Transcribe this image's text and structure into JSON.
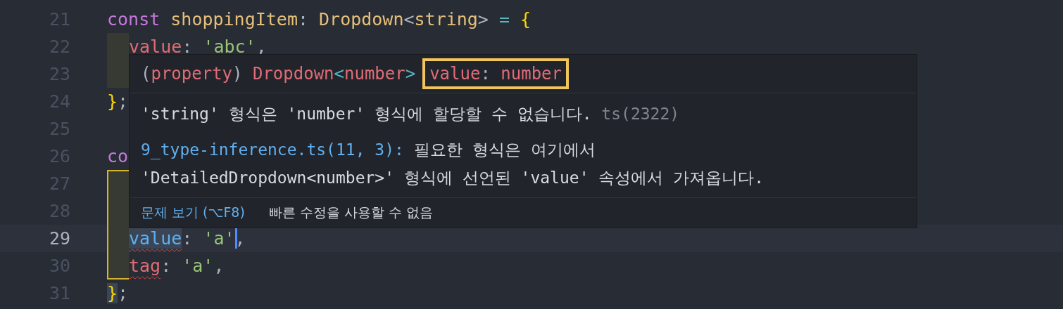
{
  "editor": {
    "lines": [
      {
        "number": "21",
        "active": false,
        "tokens": [
          {
            "text": "const",
            "kind": "keyword"
          },
          {
            "text": " shoppingItem",
            "kind": "type"
          },
          {
            "text": ": ",
            "kind": "punct"
          },
          {
            "text": "Dropdown",
            "kind": "type"
          },
          {
            "text": "<",
            "kind": "punct"
          },
          {
            "text": "string",
            "kind": "type"
          },
          {
            "text": ">",
            "kind": "punct"
          },
          {
            "text": " = ",
            "kind": "operator"
          },
          {
            "text": "{",
            "kind": "brace"
          }
        ]
      },
      {
        "number": "22",
        "active": false,
        "indent": true,
        "tokens": [
          {
            "text": "value",
            "kind": "property"
          },
          {
            "text": ": ",
            "kind": "punct"
          },
          {
            "text": "'abc'",
            "kind": "string"
          },
          {
            "text": ",",
            "kind": "punct"
          }
        ]
      },
      {
        "number": "23",
        "active": false,
        "indent": true
      },
      {
        "number": "24",
        "active": false,
        "tokens": [
          {
            "text": "}",
            "kind": "brace"
          },
          {
            "text": ";",
            "kind": "punct"
          }
        ]
      },
      {
        "number": "25",
        "active": false
      },
      {
        "number": "26",
        "active": false,
        "tokens": [
          {
            "text": "co",
            "kind": "keyword"
          }
        ]
      },
      {
        "number": "27",
        "active": false,
        "indent": true,
        "bracket_guide": true
      },
      {
        "number": "28",
        "active": false,
        "indent": true,
        "bracket_guide": true
      },
      {
        "number": "29",
        "active": true,
        "indent": true,
        "bracket_guide": true,
        "tokens": [
          {
            "text": "value",
            "kind": "link",
            "error": true,
            "highlighted": true
          },
          {
            "text": ": ",
            "kind": "punct"
          },
          {
            "text": "'a'",
            "kind": "string",
            "cursor": true
          },
          {
            "text": ",",
            "kind": "punct"
          }
        ]
      },
      {
        "number": "30",
        "active": false,
        "indent": true,
        "bracket_guide": true,
        "tokens": [
          {
            "text": "tag",
            "kind": "property",
            "error": true
          },
          {
            "text": ": ",
            "kind": "punct"
          },
          {
            "text": "'a'",
            "kind": "string"
          },
          {
            "text": ",",
            "kind": "punct"
          }
        ]
      },
      {
        "number": "31",
        "active": false,
        "tokens": [
          {
            "text": "}",
            "kind": "brace",
            "highlighted": true
          },
          {
            "text": ";",
            "kind": "punct"
          }
        ]
      }
    ]
  },
  "hover": {
    "signature": [
      {
        "text": "(",
        "kind": "punct"
      },
      {
        "text": "property",
        "kind": "property"
      },
      {
        "text": ") ",
        "kind": "punct"
      },
      {
        "text": "Dropdown",
        "kind": "property"
      },
      {
        "text": "<",
        "kind": "operator"
      },
      {
        "text": "number",
        "kind": "property"
      },
      {
        "text": ">",
        "kind": "operator"
      }
    ],
    "annotated": [
      {
        "text": "value",
        "kind": "property"
      },
      {
        "text": ": ",
        "kind": "punct"
      },
      {
        "text": "number",
        "kind": "property"
      }
    ],
    "message": "'string' 형식은 'number' 형식에 할당할 수 없습니다.",
    "code": "ts(2322)",
    "related_link": "9_type-inference.ts(11, 3):",
    "related_text": "필요한 형식은 여기에서",
    "related_detail": "'DetailedDropdown<number>' 형식에 선언된 'value' 속성에서 가져옵니다.",
    "footer_link": "문제 보기 (⌥F8)",
    "footer_text": "빠른 수정을 사용할 수 없음"
  }
}
